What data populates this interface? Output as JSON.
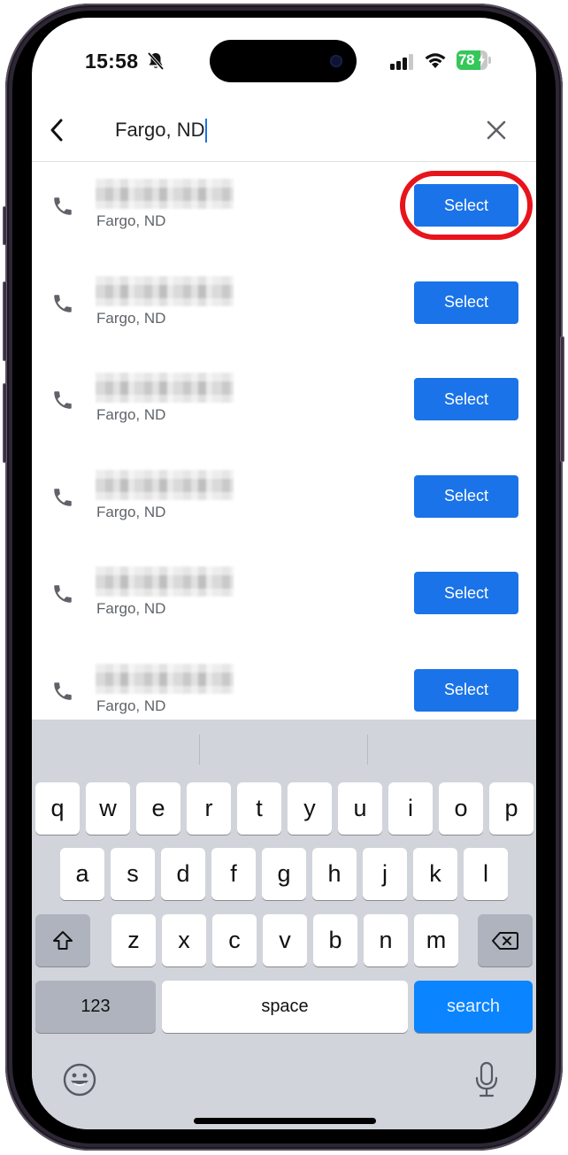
{
  "status_bar": {
    "time": "15:58",
    "silent_mode": true,
    "battery_percent": 78,
    "battery_label": "78",
    "battery_charging": true,
    "signal_bars_active": 3,
    "signal_bars_total": 4
  },
  "search": {
    "query": "Fargo, ND",
    "back_icon": "chevron-left-icon",
    "clear_icon": "close-icon"
  },
  "results": [
    {
      "number": "[redacted]",
      "location": "Fargo, ND",
      "action": "Select",
      "highlighted": true
    },
    {
      "number": "[redacted]",
      "location": "Fargo, ND",
      "action": "Select",
      "highlighted": false
    },
    {
      "number": "[redacted]",
      "location": "Fargo, ND",
      "action": "Select",
      "highlighted": false
    },
    {
      "number": "[redacted]",
      "location": "Fargo, ND",
      "action": "Select",
      "highlighted": false
    },
    {
      "number": "[redacted]",
      "location": "Fargo, ND",
      "action": "Select",
      "highlighted": false
    },
    {
      "number": "[redacted]",
      "location": "Fargo, ND",
      "action": "Select",
      "highlighted": false
    }
  ],
  "keyboard": {
    "row1": [
      "q",
      "w",
      "e",
      "r",
      "t",
      "y",
      "u",
      "i",
      "o",
      "p"
    ],
    "row2": [
      "a",
      "s",
      "d",
      "f",
      "g",
      "h",
      "j",
      "k",
      "l"
    ],
    "row3": [
      "z",
      "x",
      "c",
      "v",
      "b",
      "n",
      "m"
    ],
    "numbers_label": "123",
    "space_label": "space",
    "return_label": "search",
    "shift_icon": "shift-icon",
    "delete_icon": "backspace-icon",
    "emoji_icon": "emoji-icon",
    "dictation_icon": "microphone-icon"
  },
  "colors": {
    "accent_blue": "#1a73e8",
    "highlight_red": "#e8141c",
    "keyboard_bg": "#d1d4db",
    "search_key": "#0a84ff",
    "battery_green": "#34c759"
  }
}
